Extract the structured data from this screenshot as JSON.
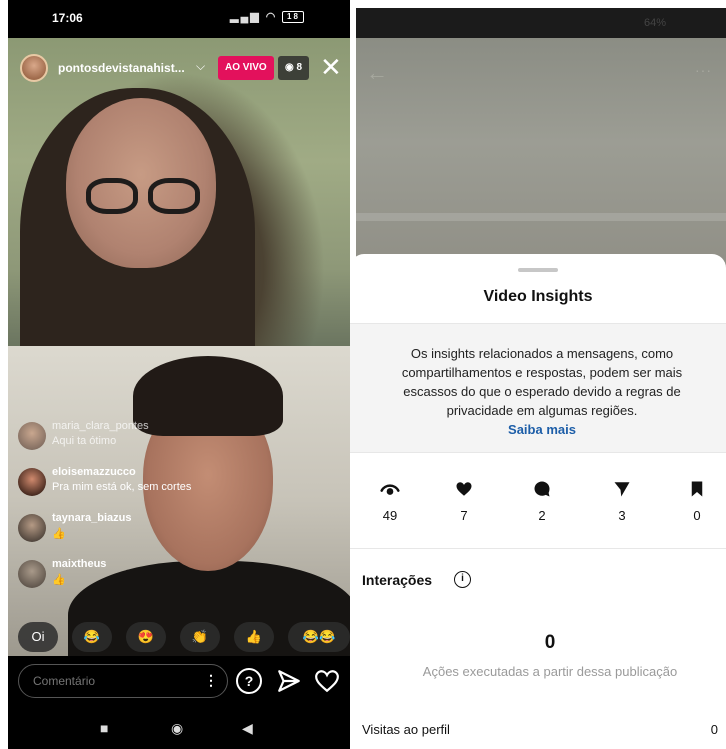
{
  "live": {
    "status_bar": {
      "time": "17:06",
      "battery": "18"
    },
    "host": {
      "username": "pontosdevistanahist..."
    },
    "live_badge": "AO VIVO",
    "viewer_count": "8",
    "comments": [
      {
        "user": "maria_clara_pontes",
        "text": "Aqui ta ótimo"
      },
      {
        "user": "eloisemazzucco",
        "text": "Pra mim está ok, sem cortes"
      },
      {
        "user": "taynara_biazus",
        "text": "👍"
      },
      {
        "user": "maixtheus",
        "text": "👍"
      }
    ],
    "quick_reactions": [
      "Oi",
      "😂",
      "😍",
      "👏",
      "👍",
      "😂😂😂"
    ],
    "composer": {
      "placeholder": "Comentário"
    }
  },
  "insights": {
    "status_bar": {
      "battery": "64%"
    },
    "title": "Video Insights",
    "notice": "Os insights relacionados a mensagens, como compartilhamentos e respostas, podem ser mais escassos do que o esperado devido a regras de privacidade em algumas regiões.",
    "notice_link": "Saiba mais",
    "metrics": [
      {
        "icon": "eye-icon",
        "value": "49"
      },
      {
        "icon": "heart-icon",
        "value": "7"
      },
      {
        "icon": "comment-icon",
        "value": "2"
      },
      {
        "icon": "send-icon",
        "value": "3"
      },
      {
        "icon": "bookmark-icon",
        "value": "0"
      }
    ],
    "interactions": {
      "title": "Interações",
      "total": "0",
      "caption": "Ações executadas a partir dessa publicação",
      "profile_visits_label": "Visitas ao perfil",
      "profile_visits_value": "0"
    }
  }
}
